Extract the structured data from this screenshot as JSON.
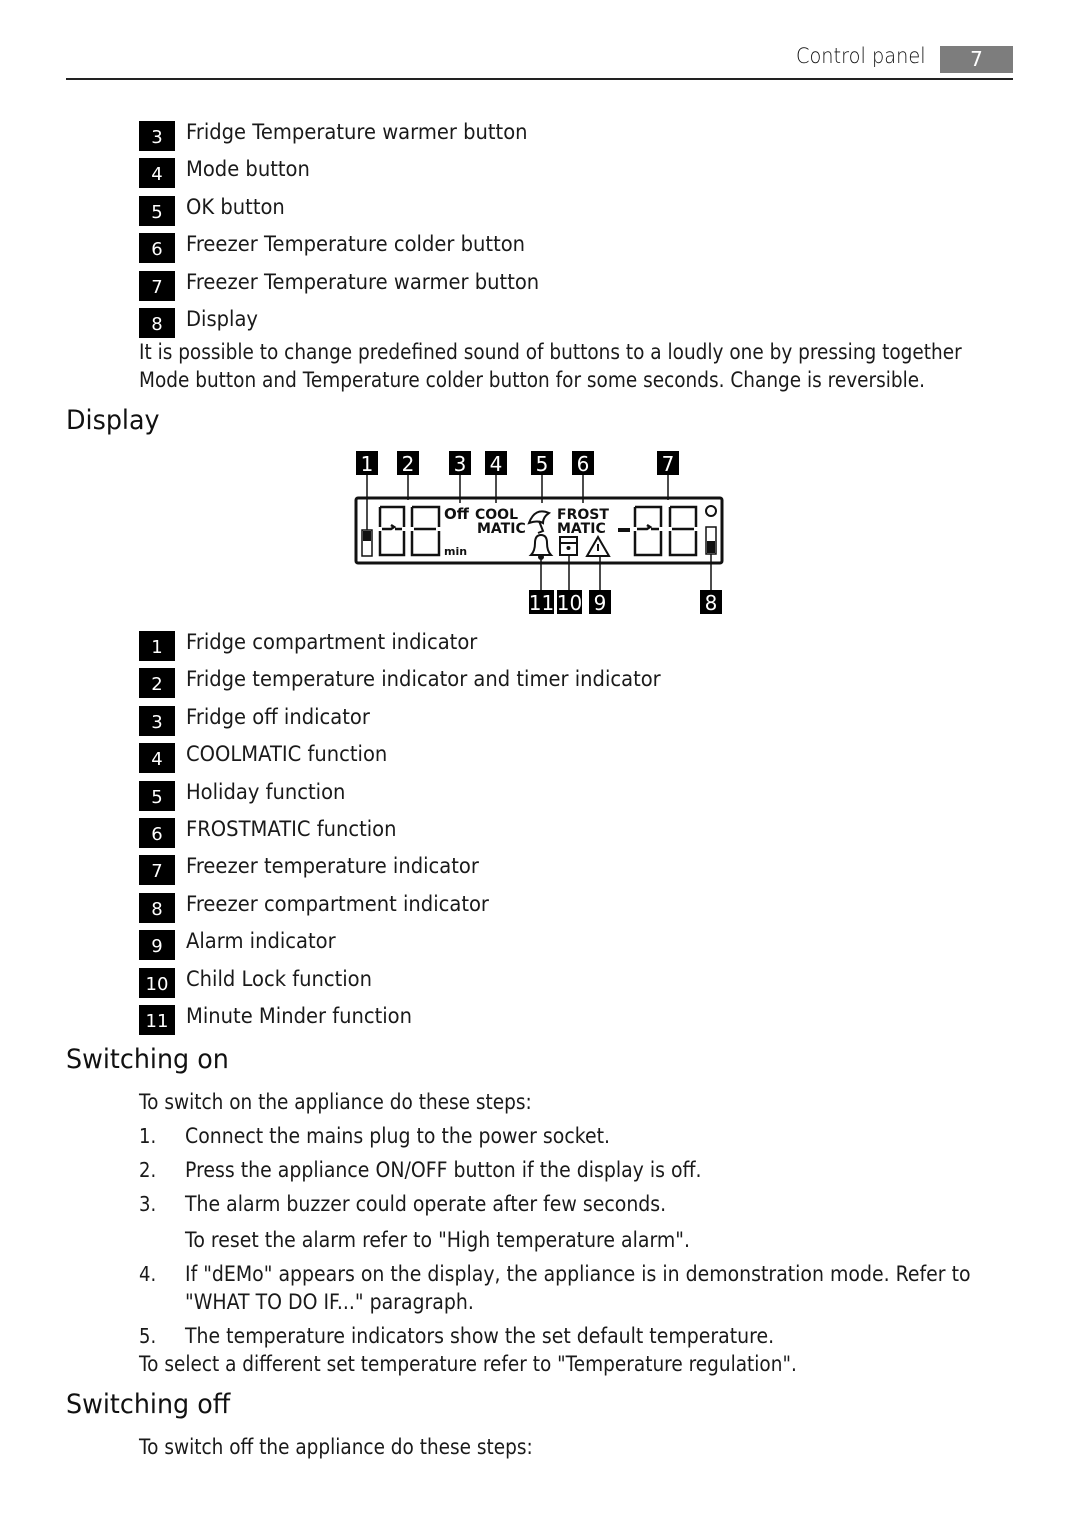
{
  "header": {
    "section_title": "Control panel",
    "page_number": "7"
  },
  "control_panel_items": [
    {
      "num": "3",
      "label": "Fridge Temperature warmer button"
    },
    {
      "num": "4",
      "label": "Mode button"
    },
    {
      "num": "5",
      "label": "OK button"
    },
    {
      "num": "6",
      "label": "Freezer Temperature colder button"
    },
    {
      "num": "7",
      "label": "Freezer Temperature warmer button"
    },
    {
      "num": "8",
      "label": "Display"
    }
  ],
  "sound_note": {
    "line1": "It is possible to change predefined sound of buttons to a loudly one by pressing together",
    "line2": "Mode button and Temperature colder button for some seconds. Change is reversible."
  },
  "display_section": {
    "heading": "Display",
    "diagram": {
      "callouts_top": [
        "1",
        "2",
        "3",
        "4",
        "5",
        "6",
        "7"
      ],
      "callouts_bottom": [
        "11",
        "10",
        "9",
        "8"
      ],
      "lcd_labels": {
        "off": "Off",
        "cool": "COOL",
        "matic1": "MATIC",
        "frost": "FROST",
        "matic2": "MATIC",
        "min": "min",
        "minus": "-"
      },
      "icons": [
        "fridge-compartment-icon",
        "umbrella-holiday-icon",
        "bell-icon",
        "child-lock-icon",
        "warning-triangle-icon",
        "degree-icon",
        "freezer-compartment-icon"
      ]
    },
    "items": [
      {
        "num": "1",
        "label": "Fridge compartment indicator"
      },
      {
        "num": "2",
        "label": "Fridge temperature indicator and timer indicator"
      },
      {
        "num": "3",
        "label": "Fridge off indicator"
      },
      {
        "num": "4",
        "label": "COOLMATIC function"
      },
      {
        "num": "5",
        "label": "Holiday function"
      },
      {
        "num": "6",
        "label": "FROSTMATIC function"
      },
      {
        "num": "7",
        "label": "Freezer temperature indicator"
      },
      {
        "num": "8",
        "label": "Freezer compartment indicator"
      },
      {
        "num": "9",
        "label": "Alarm indicator"
      },
      {
        "num": "10",
        "label": "Child Lock function"
      },
      {
        "num": "11",
        "label": "Minute Minder function"
      }
    ]
  },
  "switching_on": {
    "heading": "Switching on",
    "intro": "To switch on the appliance do these steps:",
    "steps": [
      {
        "num": "1.",
        "text": "Connect the mains plug to the power socket."
      },
      {
        "num": "2.",
        "text": "Press the appliance ON/OFF button if the display is off."
      },
      {
        "num": "3.",
        "text": "The alarm buzzer could operate after few seconds."
      },
      {
        "num": "",
        "text": "To reset the alarm refer to \"High temperature alarm\"."
      },
      {
        "num": "4.",
        "text": "If \"dEMo\" appears on the display, the appliance is in demonstration mode. Refer to"
      },
      {
        "num": "",
        "text": "\"WHAT TO DO IF...\" paragraph."
      },
      {
        "num": "5.",
        "text": "The temperature indicators show the set default temperature."
      }
    ],
    "outro": "To select a different set temperature refer to \"Temperature regulation\"."
  },
  "switching_off": {
    "heading": "Switching off",
    "intro": "To switch off the appliance do these steps:"
  }
}
